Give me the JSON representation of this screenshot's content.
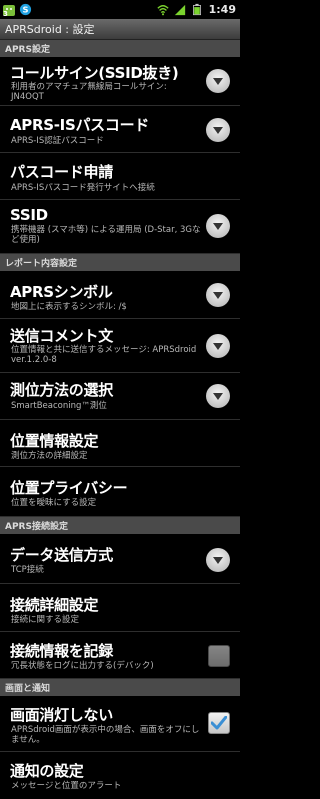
{
  "status_bar": {
    "time": "1:49",
    "notification_count": "3",
    "icons": [
      "android-notification-icon",
      "skype-icon",
      "wifi-icon",
      "signal-icon",
      "battery-icon"
    ]
  },
  "title_bar": {
    "title": "APRSdroid : 設定"
  },
  "sections": [
    {
      "header": "APRS設定",
      "items": [
        {
          "title": "コールサイン(SSID抜き)",
          "summary": "利用者のアマチュア無線局コールサイン: JN4OQT",
          "widget": "spinner"
        },
        {
          "title": "APRS-ISパスコード",
          "summary": "APRS-IS認証パスコード",
          "widget": "spinner"
        },
        {
          "title": "パスコード申請",
          "summary": "APRS-ISパスコード発行サイトへ接続",
          "widget": "none"
        },
        {
          "title": "SSID",
          "summary": "携帯機器 (スマホ等) による運用局 (D-Star, 3Gなど使用)",
          "widget": "spinner"
        }
      ]
    },
    {
      "header": "レポート内容設定",
      "items": [
        {
          "title": "APRSシンボル",
          "summary": "地図上に表示するシンボル: /$",
          "widget": "spinner"
        },
        {
          "title": "送信コメント文",
          "summary": "位置情報と共に送信するメッセージ: APRSdroid ver.1.2.0-8",
          "widget": "spinner"
        },
        {
          "title": "測位方法の選択",
          "summary": "SmartBeaconing™測位",
          "widget": "spinner"
        },
        {
          "title": "位置情報設定",
          "summary": "測位方法の詳細設定",
          "widget": "none"
        },
        {
          "title": "位置プライバシー",
          "summary": "位置を曖昧にする設定",
          "widget": "none"
        }
      ]
    },
    {
      "header": "APRS接続設定",
      "items": [
        {
          "title": "データ送信方式",
          "summary": "TCP接続",
          "widget": "spinner"
        },
        {
          "title": "接続詳細設定",
          "summary": "接続に関する設定",
          "widget": "none"
        },
        {
          "title": "接続情報を記録",
          "summary": "冗長状態をログに出力する(デバック)",
          "widget": "checkbox",
          "checked": false
        }
      ]
    },
    {
      "header": "画面と通知",
      "items": [
        {
          "title": "画面消灯しない",
          "summary": "APRSdroid画面が表示中の場合、画面をオフにしません。",
          "widget": "checkbox",
          "checked": true
        },
        {
          "title": "通知の設定",
          "summary": "メッセージと位置のアラート",
          "widget": "none"
        }
      ]
    }
  ],
  "colors": {
    "background": "#000000",
    "section_header": "#4a4a4a",
    "checkmark": "#3b8fd4"
  }
}
